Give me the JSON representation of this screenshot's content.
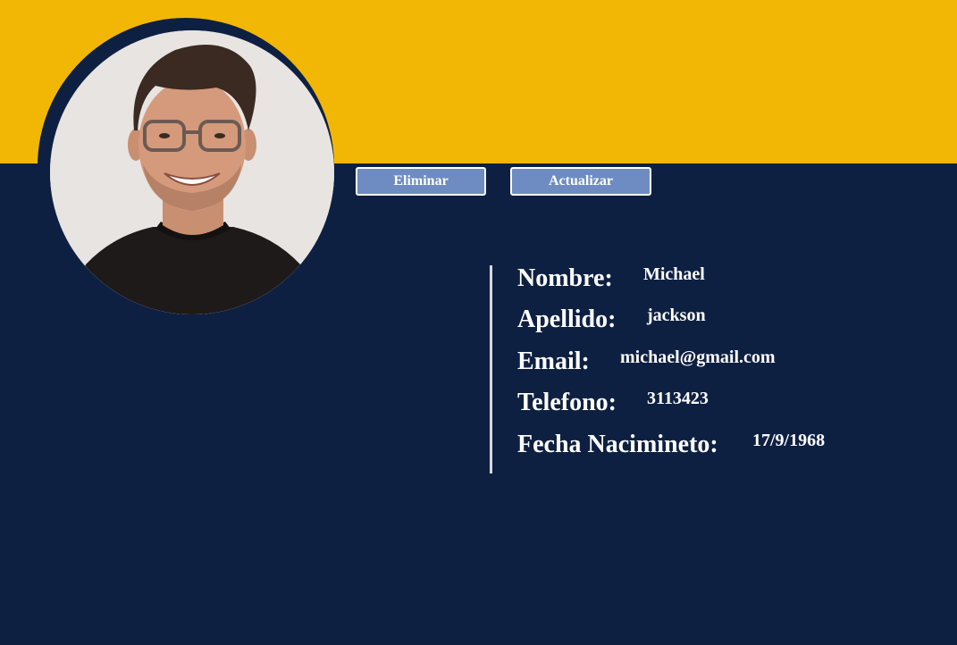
{
  "colors": {
    "header_band": "#f2b705",
    "background": "#0e2042",
    "button_fill": "#6e8cc2",
    "text": "#ffffff"
  },
  "profile": {
    "photo_icon": "user-photo"
  },
  "actions": {
    "delete_label": "Eliminar",
    "update_label": "Actualizar"
  },
  "details": {
    "nombre_label": "Nombre:",
    "nombre_value": "Michael",
    "apellido_label": "Apellido:",
    "apellido_value": "jackson",
    "email_label": "Email:",
    "email_value": "michael@gmail.com",
    "telefono_label": "Telefono:",
    "telefono_value": "3113423",
    "fecha_label": "Fecha Nacimineto:",
    "fecha_value": "17/9/1968"
  }
}
